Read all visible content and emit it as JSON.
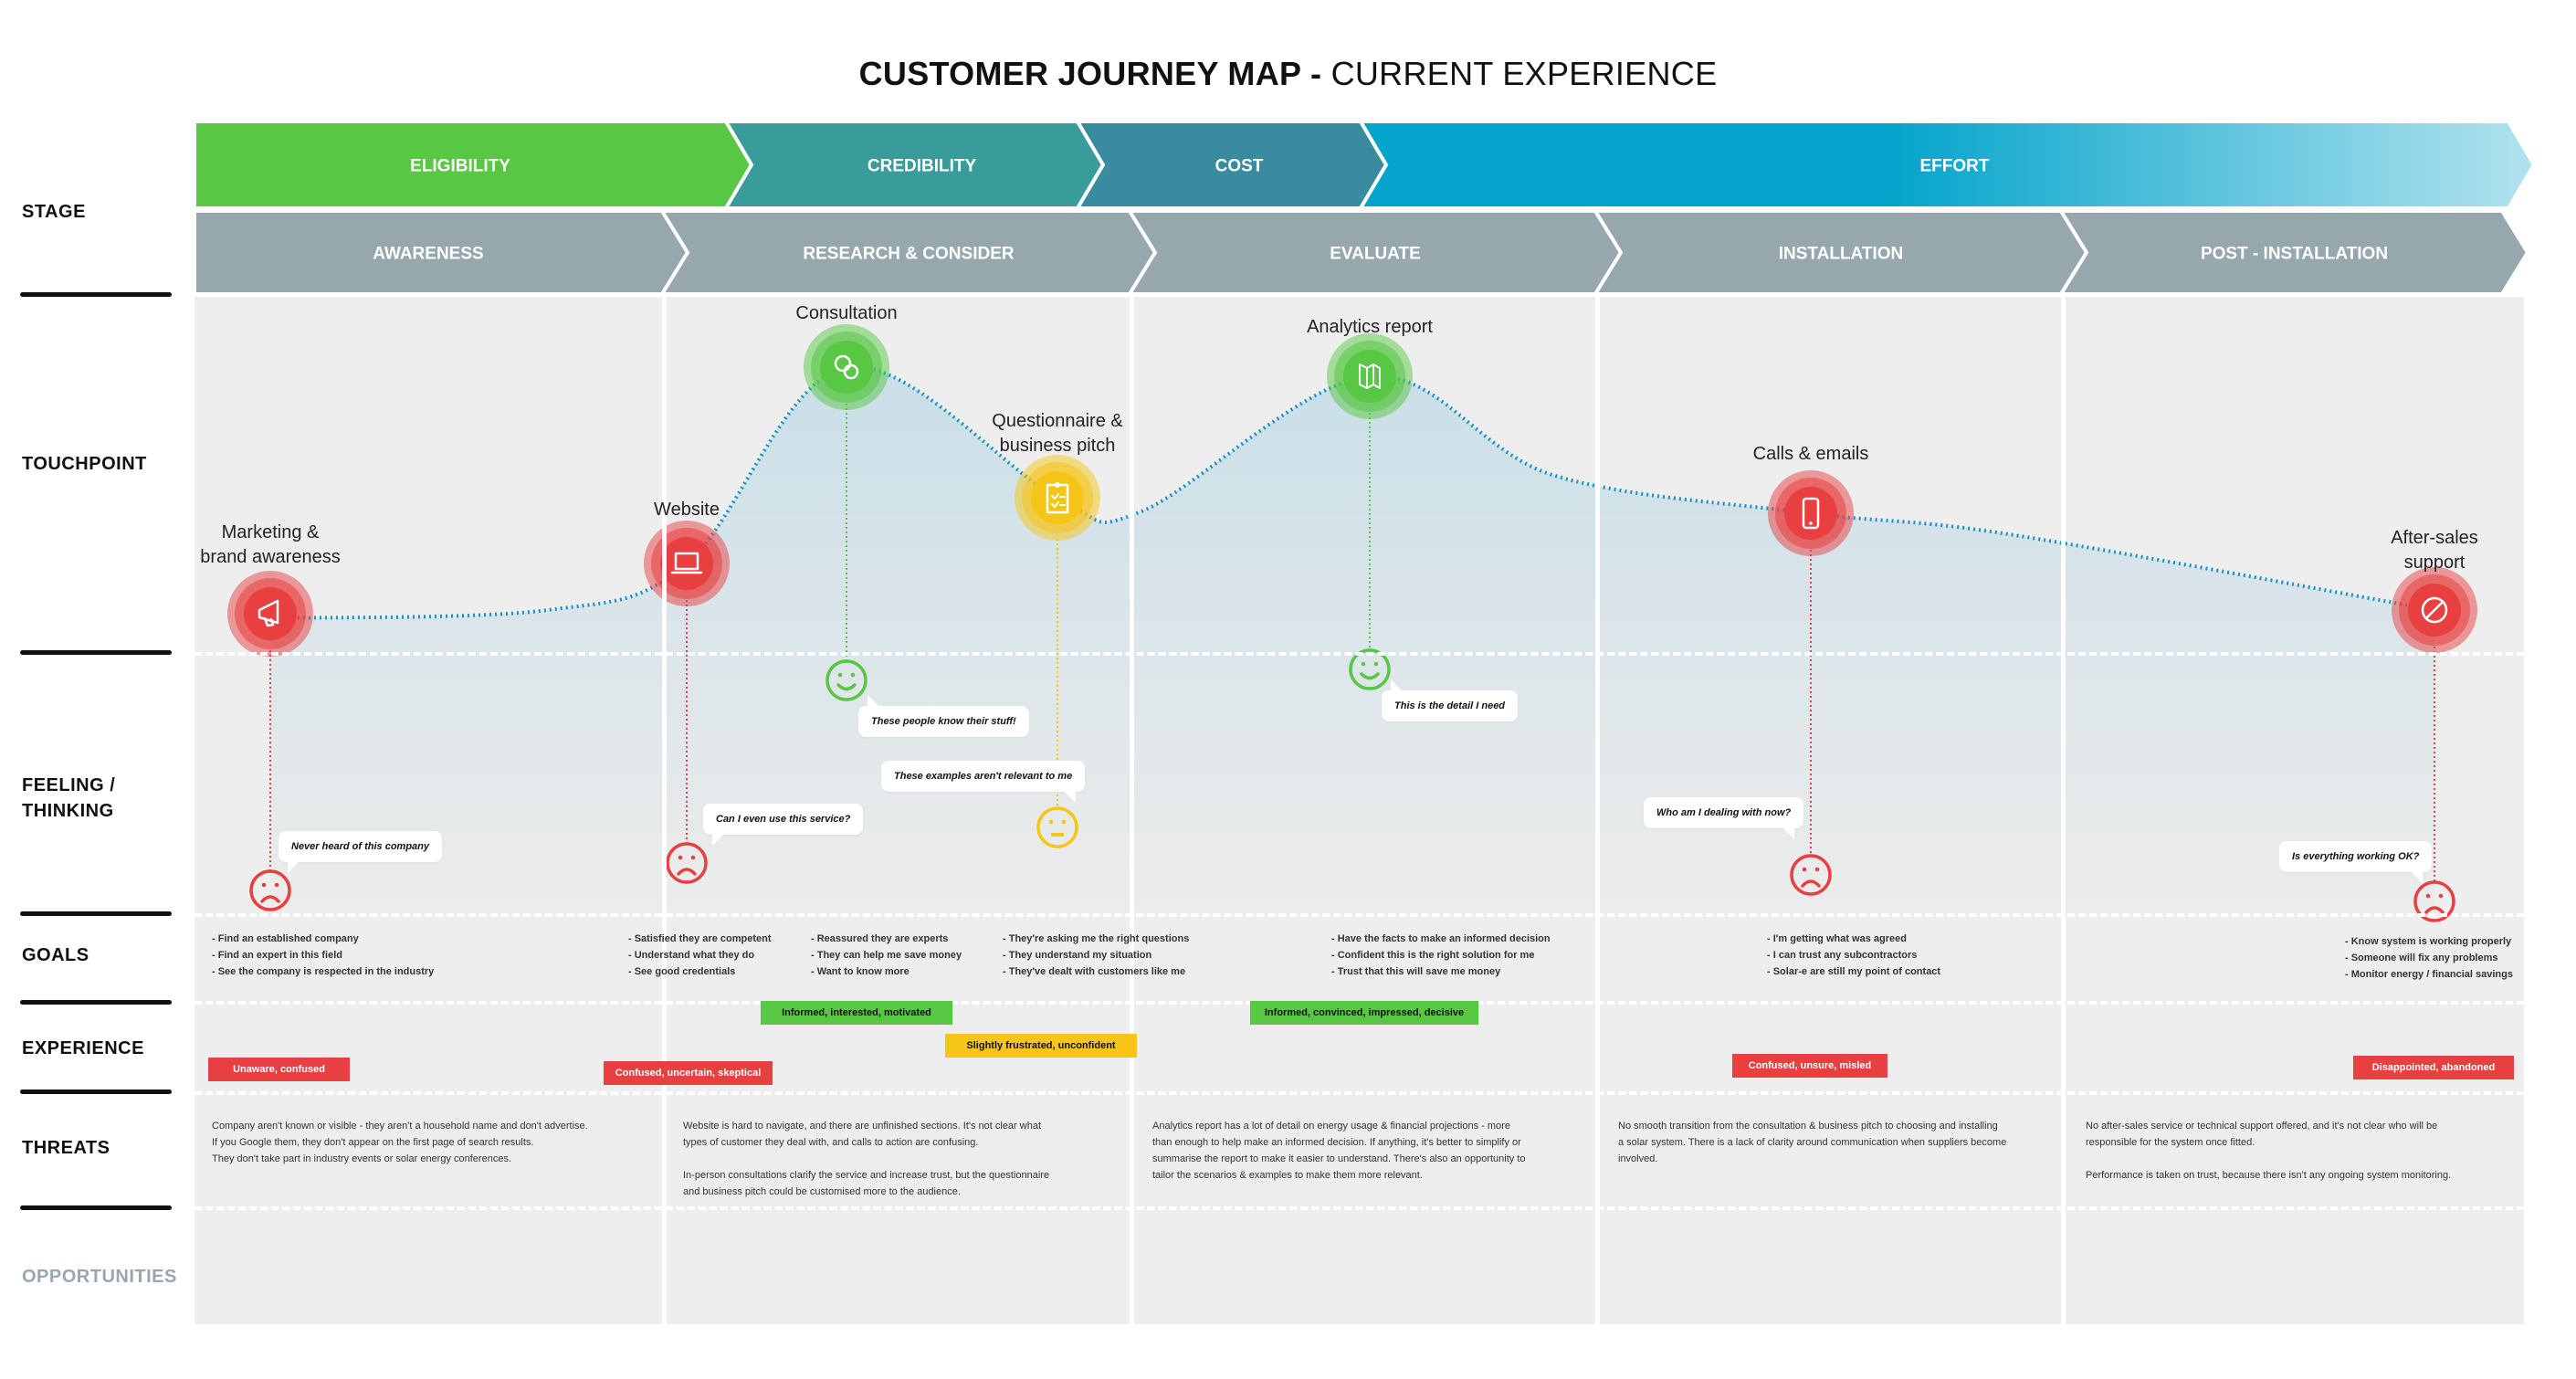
{
  "title": {
    "bold": "CUSTOMER JOURNEY MAP -",
    "light": " CURRENT EXPERIENCE"
  },
  "row_labels": {
    "stage": "STAGE",
    "touchpoint": "TOUCHPOINT",
    "feeling_line1": "FEELING /",
    "feeling_line2": "THINKING",
    "goals": "GOALS",
    "experience": "EXPERIENCE",
    "threats": "THREATS",
    "opportunities": "OPPORTUNITIES"
  },
  "phases": [
    {
      "label": "ELIGIBILITY",
      "color": "#57c744"
    },
    {
      "label": "CREDIBILITY",
      "color": "#3a9b9b"
    },
    {
      "label": "COST",
      "color": "#3a8aa0"
    },
    {
      "label": "EFFORT",
      "color": "#04a4cc",
      "fade_to": "#b3e3ee"
    }
  ],
  "stages": [
    {
      "label": "AWARENESS"
    },
    {
      "label": "RESEARCH & CONSIDER"
    },
    {
      "label": "EVALUATE"
    },
    {
      "label": "INSTALLATION"
    },
    {
      "label": "POST - INSTALLATION"
    }
  ],
  "colors": {
    "stage_grey": "#96a8ae",
    "positive": "#57c744",
    "neutral": "#f5c518",
    "negative": "#e84040",
    "curve": "#1592c6"
  },
  "touchpoints": [
    {
      "label_lines": [
        "Marketing &",
        "brand awareness"
      ],
      "icon": "megaphone-icon",
      "sentiment": "negative",
      "feeling": "sad",
      "thought": "Never heard of this company"
    },
    {
      "label_lines": [
        "Website"
      ],
      "icon": "laptop-icon",
      "sentiment": "negative",
      "feeling": "sad",
      "thought": "Can I even use this service?"
    },
    {
      "label_lines": [
        "Consultation"
      ],
      "icon": "chat-bubbles-icon",
      "sentiment": "positive",
      "feeling": "happy",
      "thought": "These people know their stuff!"
    },
    {
      "label_lines": [
        "Questionnaire &",
        "business pitch"
      ],
      "icon": "clipboard-checklist-icon",
      "sentiment": "neutral",
      "feeling": "neutral",
      "thought": "These examples aren't relevant to me"
    },
    {
      "label_lines": [
        "Analytics report"
      ],
      "icon": "map-icon",
      "sentiment": "positive",
      "feeling": "happy",
      "thought": "This is the detail I need"
    },
    {
      "label_lines": [
        "Calls & emails"
      ],
      "icon": "smartphone-icon",
      "sentiment": "negative",
      "feeling": "sad",
      "thought": "Who am I dealing with now?"
    },
    {
      "label_lines": [
        "After-sales",
        "support"
      ],
      "icon": "no-entry-icon",
      "sentiment": "negative",
      "feeling": "sad",
      "thought": "Is everything working OK?"
    }
  ],
  "goals": [
    [
      "- Find an established company",
      "- Find an expert in this field",
      "- See the company is respected in the industry"
    ],
    [
      "- Satisfied they are competent",
      "- Understand what they do",
      "- See good credentials"
    ],
    [
      "- Reassured they are experts",
      "- They can help me save money",
      "- Want to know more"
    ],
    [
      "- They're asking me the right questions",
      "- They understand my situation",
      "- They've dealt with customers like me"
    ],
    [
      "- Have the facts to make an informed decision",
      "- Confident this is the right solution for me",
      "- Trust that this will save me money"
    ],
    [
      "- I'm getting what was agreed",
      "- I can trust any subcontractors",
      "- Solar-e are still my point of contact"
    ],
    [
      "- Know system is working properly",
      "- Someone will fix any problems",
      "- Monitor energy / financial savings"
    ]
  ],
  "experience": [
    {
      "label": "Unaware, confused",
      "sentiment": "red"
    },
    {
      "label": "Confused, uncertain, skeptical",
      "sentiment": "red"
    },
    {
      "label": "Informed, interested, motivated",
      "sentiment": "green"
    },
    {
      "label": "Slightly frustrated, unconfident",
      "sentiment": "yellow"
    },
    {
      "label": "Informed, convinced, impressed, decisive",
      "sentiment": "green"
    },
    {
      "label": "Confused, unsure, misled",
      "sentiment": "red"
    },
    {
      "label": "Disappointed, abandoned",
      "sentiment": "red"
    }
  ],
  "threats": [
    {
      "paragraphs": [
        "Company aren't known or visible - they aren't a household name and don't advertise.\nIf you Google them, they don't appear on the first page of search results.\nThey don't take part in industry events or solar energy conferences."
      ]
    },
    {
      "paragraphs": [
        "Website is hard to navigate, and there are unfinished sections. It's not clear what\ntypes of customer they deal with, and calls to action are confusing.",
        "In-person consultations clarify the service and increase trust, but the questionnaire\nand business pitch could be customised more to the audience."
      ]
    },
    {
      "paragraphs": [
        "Analytics report has a lot of detail on energy usage & financial projections - more\nthan enough to help make an informed decision. If anything, it's better to simplify or\nsummarise the report to make it easier to understand. There's also an opportunity to\ntailor the scenarios & examples to make them more relevant."
      ]
    },
    {
      "paragraphs": [
        "No smooth transition from the consultation & business pitch to choosing and installing\na solar system. There is a lack of clarity around communication when suppliers become\ninvolved."
      ]
    },
    {
      "paragraphs": [
        "No after-sales service or technical support offered, and it's not clear who will be\nresponsible for the system once fitted.",
        "Performance is taken on trust, because there isn't any ongoing system monitoring."
      ]
    }
  ],
  "opportunities": []
}
